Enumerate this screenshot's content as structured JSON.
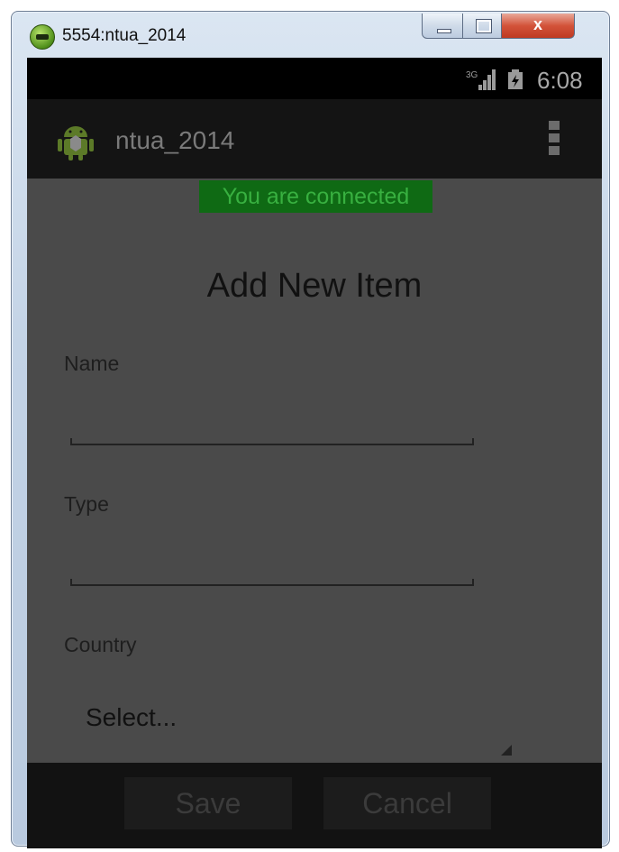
{
  "window": {
    "title": "5554:ntua_2014",
    "close_glyph": "x"
  },
  "statusbar": {
    "network": "3G",
    "clock": "6:08"
  },
  "actionbar": {
    "app_name": "ntua_2014"
  },
  "banner": {
    "text": "You are connected",
    "bg_color": "#0f6a14",
    "text_color": "#38b040"
  },
  "form": {
    "title": "Add New Item",
    "name_label": "Name",
    "name_value": "",
    "type_label": "Type",
    "type_value": "",
    "country_label": "Country",
    "country_selected": "Select..."
  },
  "buttons": {
    "save_label": "Save",
    "cancel_label": "Cancel"
  }
}
